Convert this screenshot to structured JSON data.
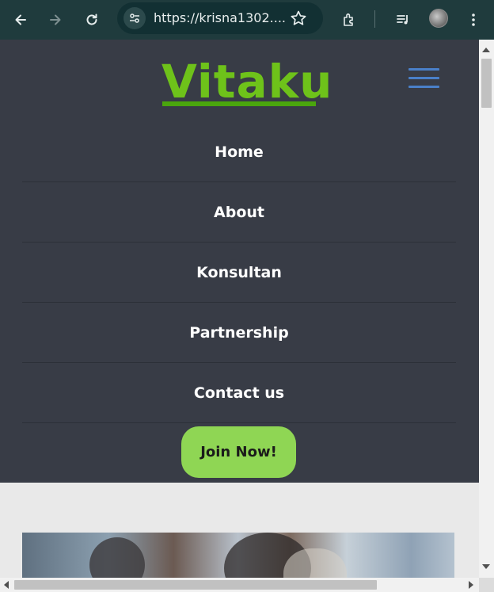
{
  "browser": {
    "url": "https://krisna1302....",
    "icons": [
      "back-arrow-icon",
      "forward-arrow-icon",
      "reload-icon",
      "site-info-icon",
      "bookmark-star-icon",
      "extensions-icon",
      "media-control-icon",
      "profile-avatar",
      "kebab-menu-icon"
    ]
  },
  "site": {
    "logo": "Vitaku",
    "menu": [
      {
        "label": "Home"
      },
      {
        "label": "About"
      },
      {
        "label": "Konsultan"
      },
      {
        "label": "Partnership"
      },
      {
        "label": "Contact us"
      }
    ],
    "cta": "Join Now!"
  },
  "colors": {
    "nav_bg": "#383c46",
    "logo_green": "#6ec21a",
    "cta_green": "#8fd654",
    "hamburger_blue": "#4a80c9",
    "browser_bar": "#1f3b3d"
  }
}
